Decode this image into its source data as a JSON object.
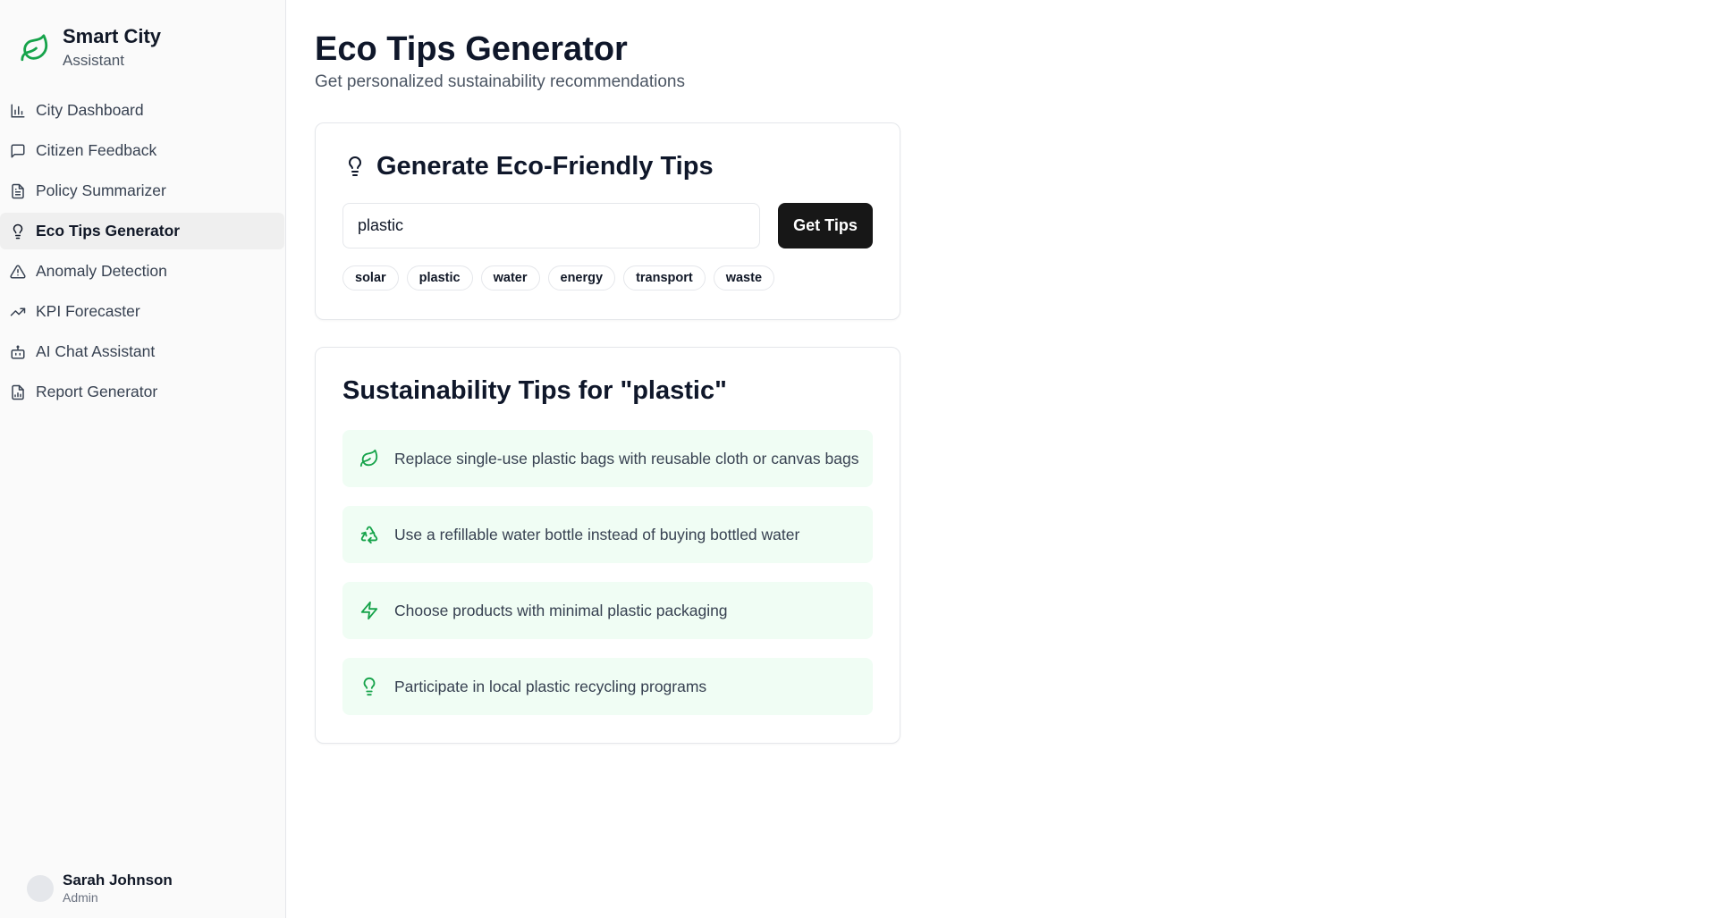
{
  "app": {
    "title": "Smart City",
    "subtitle": "Assistant"
  },
  "sidebar": {
    "items": [
      {
        "label": "City Dashboard",
        "icon": "bar-chart-icon"
      },
      {
        "label": "Citizen Feedback",
        "icon": "message-square-icon"
      },
      {
        "label": "Policy Summarizer",
        "icon": "file-text-icon"
      },
      {
        "label": "Eco Tips Generator",
        "icon": "lightbulb-icon",
        "active": true
      },
      {
        "label": "Anomaly Detection",
        "icon": "alert-triangle-icon"
      },
      {
        "label": "KPI Forecaster",
        "icon": "trending-up-icon"
      },
      {
        "label": "AI Chat Assistant",
        "icon": "bot-icon"
      },
      {
        "label": "Report Generator",
        "icon": "file-chart-icon"
      }
    ]
  },
  "user": {
    "name": "Sarah Johnson",
    "role": "Admin"
  },
  "page": {
    "title": "Eco Tips Generator",
    "subtitle": "Get personalized sustainability recommendations"
  },
  "generator": {
    "title": "Generate Eco-Friendly Tips",
    "input_value": "plastic",
    "button_label": "Get Tips",
    "chips": [
      "solar",
      "plastic",
      "water",
      "energy",
      "transport",
      "waste"
    ]
  },
  "results": {
    "title": "Sustainability Tips for \"plastic\"",
    "tips": [
      {
        "text": "Replace single-use plastic bags with reusable cloth or canvas bags",
        "icon": "leaf-icon"
      },
      {
        "text": "Use a refillable water bottle instead of buying bottled water",
        "icon": "recycle-icon"
      },
      {
        "text": "Choose products with minimal plastic packaging",
        "icon": "zap-icon"
      },
      {
        "text": "Participate in local plastic recycling programs",
        "icon": "lightbulb-icon"
      }
    ]
  },
  "colors": {
    "accent_green": "#16a34a",
    "tip_bg": "#f0fdf4",
    "button_bg": "#171717"
  }
}
